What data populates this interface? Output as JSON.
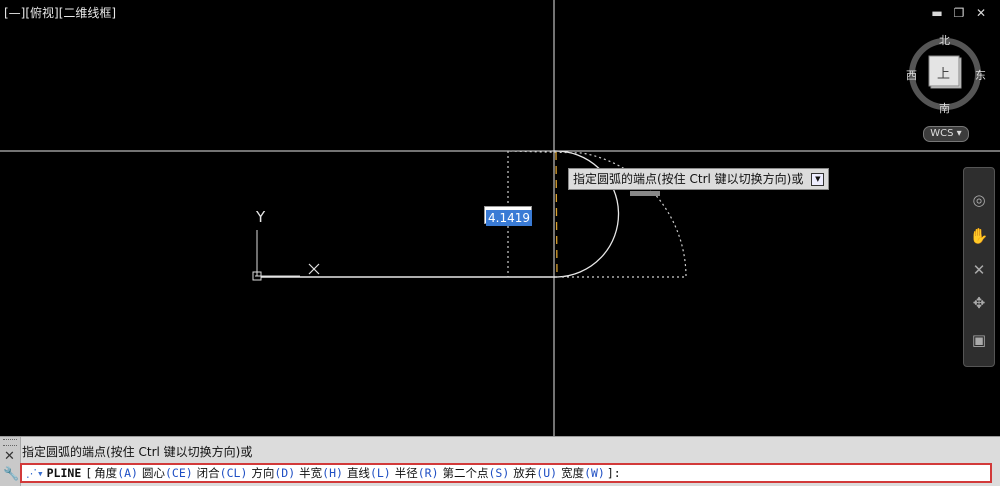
{
  "viewport": {
    "label": "[—][俯视][二维线框]",
    "window_controls": [
      "▬",
      "❐",
      "✕"
    ],
    "ucs_axis_label": "Y",
    "dynamic_input_value": "4.1419",
    "tooltip_text": "指定圆弧的端点(按住 Ctrl 键以切换方向)或"
  },
  "viewcube": {
    "north": "北",
    "south": "南",
    "east": "东",
    "west": "西",
    "face": "上",
    "wcs_label": "WCS"
  },
  "navbar_icons": [
    "steering-wheel-icon",
    "pan-icon",
    "zoom-icon",
    "orbit-icon",
    "showmotion-icon"
  ],
  "command": {
    "history": "指定圆弧的端点(按住 Ctrl 键以切换方向)或",
    "program": "PLINE",
    "options": [
      {
        "label": "角度",
        "key": "A"
      },
      {
        "label": "圆心",
        "key": "CE"
      },
      {
        "label": "闭合",
        "key": "CL"
      },
      {
        "label": "方向",
        "key": "D"
      },
      {
        "label": "半宽",
        "key": "H"
      },
      {
        "label": "直线",
        "key": "L"
      },
      {
        "label": "半径",
        "key": "R"
      },
      {
        "label": "第二个点",
        "key": "S"
      },
      {
        "label": "放弃",
        "key": "U"
      },
      {
        "label": "宽度",
        "key": "W"
      }
    ],
    "open_bracket": "[",
    "close_text": "]:"
  }
}
